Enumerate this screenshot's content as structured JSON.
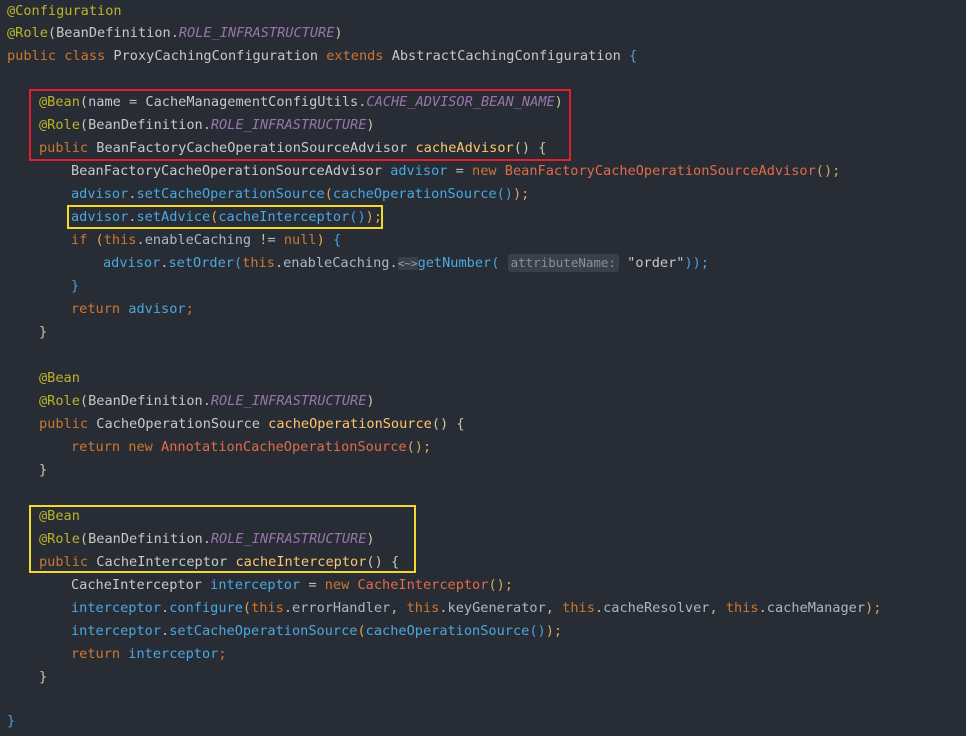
{
  "code": {
    "l1": {
      "ann": "@Configuration"
    },
    "l2": {
      "ann": "@Role",
      "p1": "(",
      "cls": "BeanDefinition",
      "dot": ".",
      "st": "ROLE_INFRASTRUCTURE",
      "p2": ")"
    },
    "l3": {
      "kw1": "public",
      "kw2": "class",
      "cls": "ProxyCachingConfiguration",
      "kw3": "extends",
      "sup": "AbstractCachingConfiguration",
      "brace": "{"
    },
    "l5": {
      "ann": "@Bean",
      "p1": "(",
      "name": "name",
      "eq": " = ",
      "cls": "CacheManagementConfigUtils",
      "dot": ".",
      "st": "CACHE_ADVISOR_BEAN_NAME",
      "p2": ")"
    },
    "l6": {
      "ann": "@Role",
      "p1": "(",
      "cls": "BeanDefinition",
      "dot": ".",
      "st": "ROLE_INFRASTRUCTURE",
      "p2": ")"
    },
    "l7": {
      "kw": "public",
      "type": "BeanFactoryCacheOperationSourceAdvisor",
      "meth": "cacheAdvisor",
      "paren": "()",
      "brace": "{"
    },
    "l8": {
      "type": "BeanFactoryCacheOperationSourceAdvisor",
      "var": "advisor",
      "eq": " = ",
      "kw": "new",
      "ctor": "BeanFactoryCacheOperationSourceAdvisor",
      "end": "();"
    },
    "l9": {
      "var": "advisor",
      "dot": ".",
      "call": "setCacheOperationSource",
      "p1": "(",
      "arg": "cacheOperationSource",
      "p2": "()",
      "end": ");"
    },
    "l10": {
      "var": "advisor",
      "dot": ".",
      "call": "setAdvice",
      "p1": "(",
      "arg": "cacheInterceptor",
      "p2": "()",
      "end": ");"
    },
    "l11": {
      "kw": "if",
      "p1": " (",
      "this": "this",
      "dot": ".",
      "fld": "enableCaching",
      "op": " != ",
      "nul": "null",
      "p2": ") ",
      "brace": "{"
    },
    "l12": {
      "var": "advisor",
      "dot": ".",
      "call": "setOrder",
      "p1": "(",
      "this": "this",
      "dot2": ".",
      "fld": "enableCaching",
      "dot3": ".",
      "fold": "<~>",
      "call2": "getNumber",
      "p2": "(",
      "hint": "attributeName:",
      "str": "\"order\"",
      "end": "));"
    },
    "l13": {
      "brace": "}"
    },
    "l14": {
      "kw": "return",
      "var": "advisor",
      "semi": ";"
    },
    "l15": {
      "brace": "}"
    },
    "l17": {
      "ann": "@Bean"
    },
    "l18": {
      "ann": "@Role",
      "p1": "(",
      "cls": "BeanDefinition",
      "dot": ".",
      "st": "ROLE_INFRASTRUCTURE",
      "p2": ")"
    },
    "l19": {
      "kw": "public",
      "type": "CacheOperationSource",
      "meth": "cacheOperationSource",
      "paren": "()",
      "brace": "{"
    },
    "l20": {
      "kw1": "return",
      "kw2": "new",
      "ctor": "AnnotationCacheOperationSource",
      "end": "();"
    },
    "l21": {
      "brace": "}"
    },
    "l23": {
      "ann": "@Bean"
    },
    "l24": {
      "ann": "@Role",
      "p1": "(",
      "cls": "BeanDefinition",
      "dot": ".",
      "st": "ROLE_INFRASTRUCTURE",
      "p2": ")"
    },
    "l25": {
      "kw": "public",
      "type": "CacheInterceptor",
      "meth": "cacheInterceptor",
      "paren": "()",
      "brace": "{"
    },
    "l26": {
      "type": "CacheInterceptor",
      "var": "interceptor",
      "eq": " = ",
      "kw": "new",
      "ctor": "CacheInterceptor",
      "end": "();"
    },
    "l27": {
      "var": "interceptor",
      "dot": ".",
      "call": "configure",
      "p1": "(",
      "t1": "this",
      "f1": "errorHandler",
      "t2": "this",
      "f2": "keyGenerator",
      "t3": "this",
      "f3": "cacheResolver",
      "t4": "this",
      "f4": "cacheManager",
      "end": ");"
    },
    "l28": {
      "var": "interceptor",
      "dot": ".",
      "call": "setCacheOperationSource",
      "p1": "(",
      "arg": "cacheOperationSource",
      "p2": "()",
      "end": ");"
    },
    "l29": {
      "kw": "return",
      "var": "interceptor",
      "semi": ";"
    },
    "l30": {
      "brace": "}"
    },
    "l32": {
      "brace": "}"
    }
  },
  "highlights": {
    "red": "#e0202b",
    "yellow": "#f2d92d"
  }
}
